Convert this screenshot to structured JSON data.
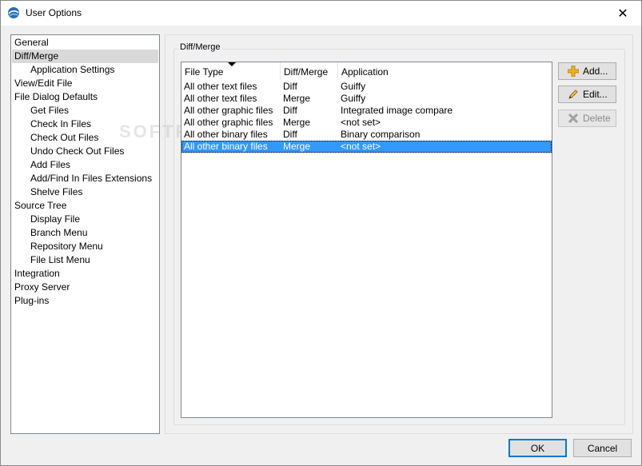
{
  "window": {
    "title": "User Options",
    "close_glyph": "✕"
  },
  "tree": {
    "items": [
      {
        "label": "General",
        "level": 0
      },
      {
        "label": "Diff/Merge",
        "level": 0,
        "selected": true
      },
      {
        "label": "Application Settings",
        "level": 1
      },
      {
        "label": "View/Edit File",
        "level": 0
      },
      {
        "label": "File Dialog Defaults",
        "level": 0
      },
      {
        "label": "Get Files",
        "level": 1
      },
      {
        "label": "Check In Files",
        "level": 1
      },
      {
        "label": "Check Out Files",
        "level": 1
      },
      {
        "label": "Undo Check Out Files",
        "level": 1
      },
      {
        "label": "Add Files",
        "level": 1
      },
      {
        "label": "Add/Find In Files Extensions",
        "level": 1
      },
      {
        "label": "Shelve Files",
        "level": 1
      },
      {
        "label": "Source Tree",
        "level": 0
      },
      {
        "label": "Display File",
        "level": 1
      },
      {
        "label": "Branch Menu",
        "level": 1
      },
      {
        "label": "Repository Menu",
        "level": 1
      },
      {
        "label": "File List Menu",
        "level": 1
      },
      {
        "label": "Integration",
        "level": 0
      },
      {
        "label": "Proxy Server",
        "level": 0
      },
      {
        "label": "Plug-ins",
        "level": 0
      }
    ]
  },
  "group": {
    "label": "Diff/Merge"
  },
  "table": {
    "columns": [
      "File Type",
      "Diff/Merge",
      "Application"
    ],
    "rows": [
      [
        "All other text files",
        "Diff",
        "Guiffy"
      ],
      [
        "All other text files",
        "Merge",
        "Guiffy"
      ],
      [
        "All other graphic files",
        "Diff",
        "Integrated image compare"
      ],
      [
        "All other graphic files",
        "Merge",
        "<not set>"
      ],
      [
        "All other binary files",
        "Diff",
        "Binary comparison"
      ],
      [
        "All other binary files",
        "Merge",
        "<not set>"
      ]
    ],
    "selected_row": 5
  },
  "buttons": {
    "add": "Add...",
    "edit": "Edit...",
    "delete": "Delete",
    "ok": "OK",
    "cancel": "Cancel"
  },
  "watermark": "SOFTPEDIA",
  "colors": {
    "selection": "#3399ff",
    "tree_selection": "#d9d9d9",
    "default_button_border": "#0078d7"
  }
}
